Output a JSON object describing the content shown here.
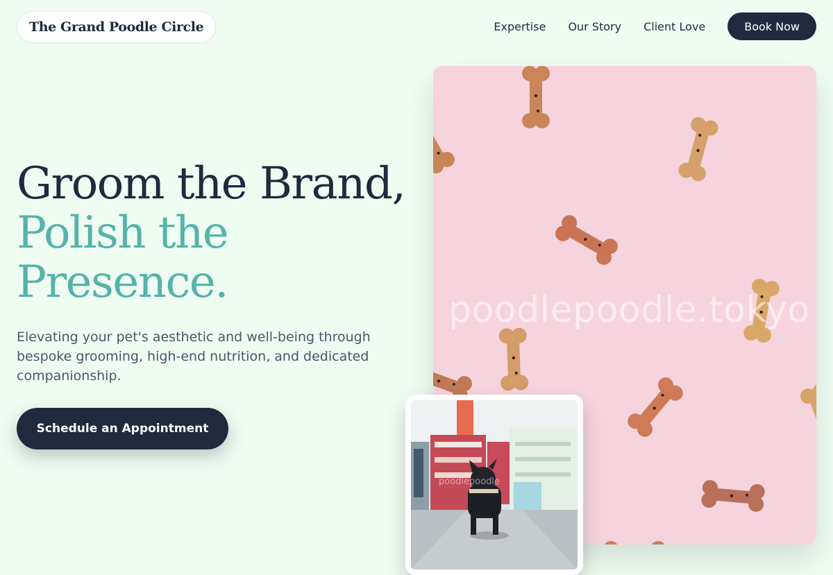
{
  "header": {
    "brand": "The Grand Poodle Circle",
    "nav": [
      {
        "label": "Expertise"
      },
      {
        "label": "Our Story"
      },
      {
        "label": "Client Love"
      }
    ],
    "cta_label": "Book Now"
  },
  "hero": {
    "title_line1": "Groom the Brand,",
    "title_line2": "Polish the",
    "title_line3": "Presence.",
    "description": "Elevating your pet's aesthetic and well-being through bespoke grooming, high-end nutrition, and dedicated companionship.",
    "button_label": "Schedule an Appointment"
  },
  "images": {
    "main_watermark": "poodlepoodle.tokyo",
    "card_watermark": "poodlepoodle"
  },
  "colors": {
    "background": "#effcf2",
    "navy": "#1f2a3d",
    "teal_accent": "#56b3aa",
    "pink_photo": "#f5d4dd"
  }
}
